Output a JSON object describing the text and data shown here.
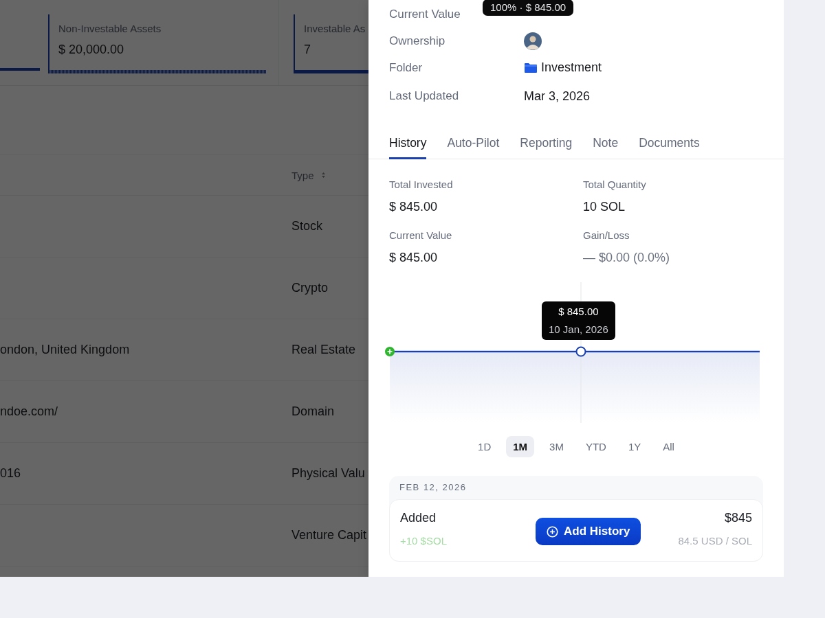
{
  "stat_cards": [
    {
      "label": "Non-Investable Assets",
      "value": "$ 20,000.00",
      "kind": "hatched"
    },
    {
      "label": "Investable As",
      "value": "7",
      "kind": "solid"
    }
  ],
  "table": {
    "columns": [
      "Type"
    ],
    "rows": [
      {
        "type": "Stock"
      },
      {
        "type": "Crypto"
      },
      {
        "column_1": "ondon, United Kingdom",
        "type": "Real Estate"
      },
      {
        "column_1": "ndoe.com/",
        "type": "Domain"
      },
      {
        "column_1": "016",
        "type": "Physical Valu"
      },
      {
        "type": "Venture Capit"
      }
    ]
  },
  "drawer": {
    "details": [
      {
        "label": "Current Value",
        "kind": "covered",
        "tooltip": "100% · $ 845.00"
      },
      {
        "label": "Ownership",
        "kind": "avatar"
      },
      {
        "label": "Folder",
        "kind": "folder",
        "value": "Investment"
      },
      {
        "label": "Last Updated",
        "kind": "text",
        "value": "Mar 3, 2026"
      }
    ],
    "tabs": [
      {
        "label": "History",
        "selected": true
      },
      {
        "label": "Auto-Pilot",
        "selected": false
      },
      {
        "label": "Reporting",
        "selected": false
      },
      {
        "label": "Note",
        "selected": false
      },
      {
        "label": "Documents",
        "selected": false
      }
    ],
    "summary": [
      {
        "label": "Total Invested",
        "value": "$ 845.00",
        "kind": "amount"
      },
      {
        "label": "Total Quantity",
        "value": "10 SOL",
        "kind": "amount"
      },
      {
        "label": "Current Value",
        "value": "$ 845.00",
        "kind": "amount"
      },
      {
        "label": "Gain/Loss",
        "value": "— $0.00 (0.0%)",
        "kind": "change"
      }
    ],
    "chart": {
      "kind": "picture",
      "tooltip_value": "$ 845.00",
      "tooltip_date": "10 Jan, 2026"
    },
    "ranges": [
      {
        "label": "1D",
        "selected": false
      },
      {
        "label": "1M",
        "selected": true
      },
      {
        "label": "3M",
        "selected": false
      },
      {
        "label": "YTD",
        "selected": false
      },
      {
        "label": "1Y",
        "selected": false
      },
      {
        "label": "All",
        "selected": false
      }
    ],
    "history": [
      {
        "date": "FEB 12, 2026",
        "entries": [
          {
            "action": "Added",
            "amount": "$845",
            "quantity": "+10 $SOL",
            "rate": "84.5 USD / SOL"
          }
        ]
      }
    ],
    "add_button": "Add History"
  }
}
